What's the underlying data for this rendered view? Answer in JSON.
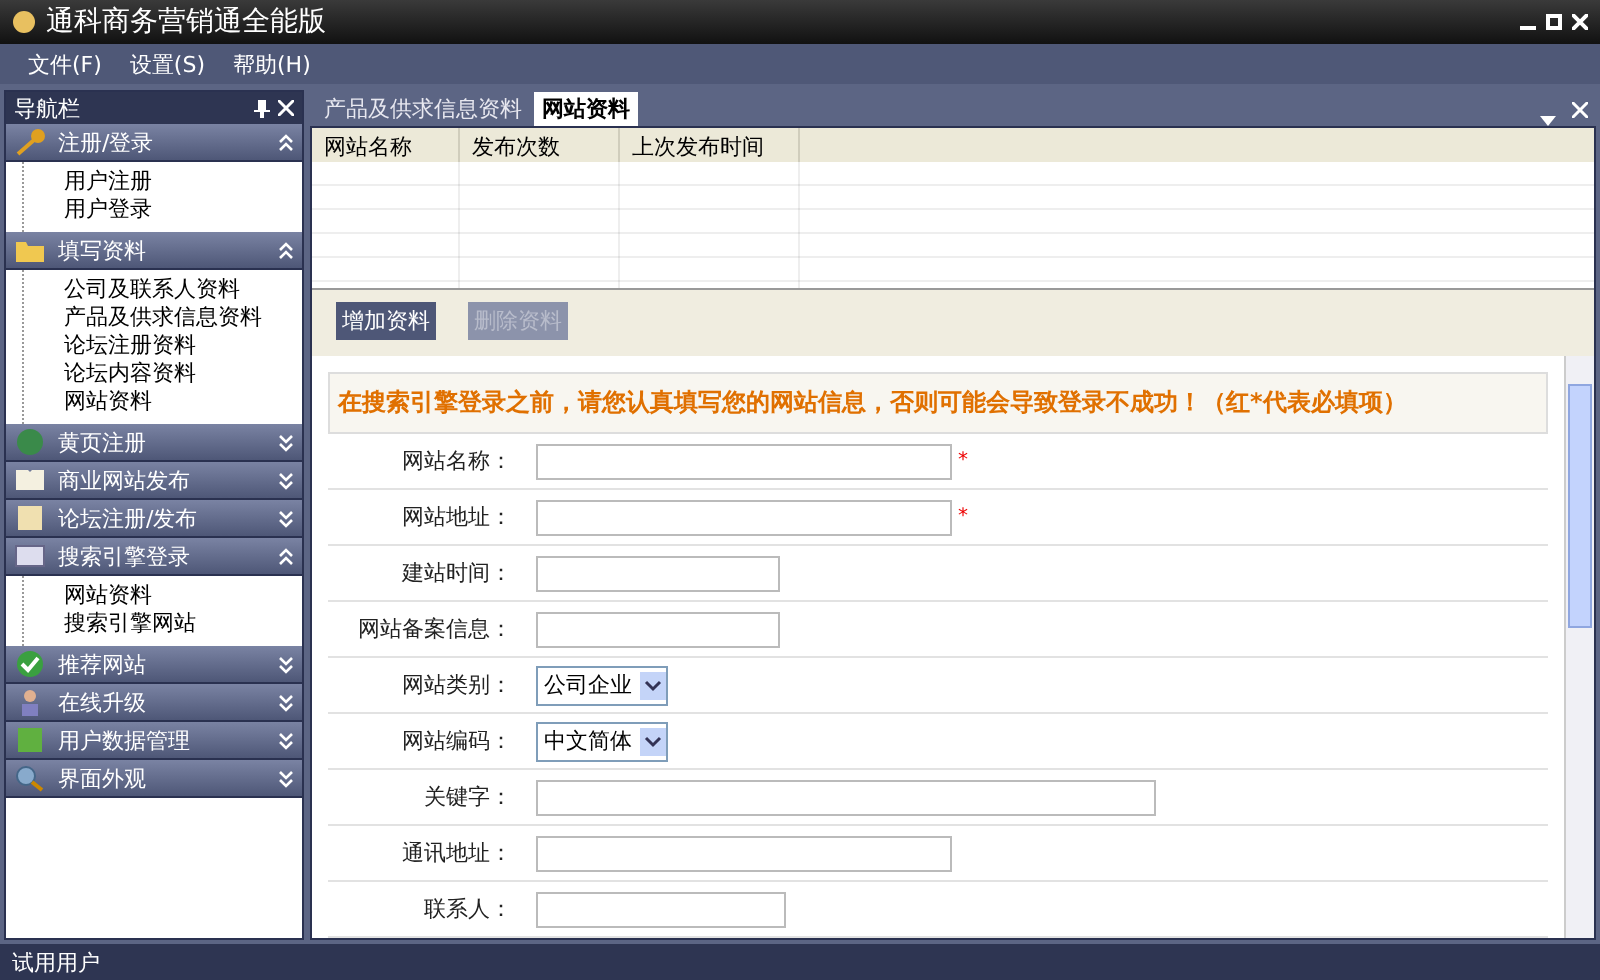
{
  "window": {
    "title": "通科商务营销通全能版"
  },
  "menu": [
    "文件(F)",
    "设置(S)",
    "帮助(H)"
  ],
  "sidebar": {
    "title": "导航栏",
    "groups": [
      {
        "label": "注册/登录",
        "expanded": true,
        "items": [
          "用户注册",
          "用户登录"
        ]
      },
      {
        "label": "填写资料",
        "expanded": true,
        "items": [
          "公司及联系人资料",
          "产品及供求信息资料",
          "论坛注册资料",
          "论坛内容资料",
          "网站资料"
        ]
      },
      {
        "label": "黄页注册",
        "expanded": false
      },
      {
        "label": "商业网站发布",
        "expanded": false
      },
      {
        "label": "论坛注册/发布",
        "expanded": false
      },
      {
        "label": "搜索引擎登录",
        "expanded": true,
        "items": [
          "网站资料",
          "搜索引擎网站"
        ]
      },
      {
        "label": "推荐网站",
        "expanded": false
      },
      {
        "label": "在线升级",
        "expanded": false
      },
      {
        "label": "用户数据管理",
        "expanded": false
      },
      {
        "label": "界面外观",
        "expanded": false
      }
    ]
  },
  "tabs": [
    {
      "label": "产品及供求信息资料",
      "selected": false
    },
    {
      "label": "网站资料",
      "selected": true
    }
  ],
  "table": {
    "columns": [
      "网站名称",
      "发布次数",
      "上次发布时间"
    ]
  },
  "buttons": [
    {
      "label": "增加资料",
      "disabled": false
    },
    {
      "label": "删除资料",
      "disabled": true
    }
  ],
  "form": {
    "notice": "在搜索引擎登录之前，请您认真填写您的网站信息，否则可能会导致登录不成功！（红*代表必填项）",
    "fields": [
      {
        "label": "网站名称：",
        "kind": "text",
        "required_mark": "*"
      },
      {
        "label": "网站地址：",
        "kind": "text",
        "required_mark": "*"
      },
      {
        "label": "建站时间：",
        "kind": "text"
      },
      {
        "label": "网站备案信息：",
        "kind": "text"
      },
      {
        "label": "网站类别：",
        "kind": "select",
        "value": "公司企业"
      },
      {
        "label": "网站编码：",
        "kind": "select",
        "value": "中文简体"
      },
      {
        "label": "关键字：",
        "kind": "text"
      },
      {
        "label": "通讯地址：",
        "kind": "text"
      },
      {
        "label": "联系人：",
        "kind": "text"
      }
    ]
  },
  "status_bar": {
    "user": "试用用户"
  }
}
